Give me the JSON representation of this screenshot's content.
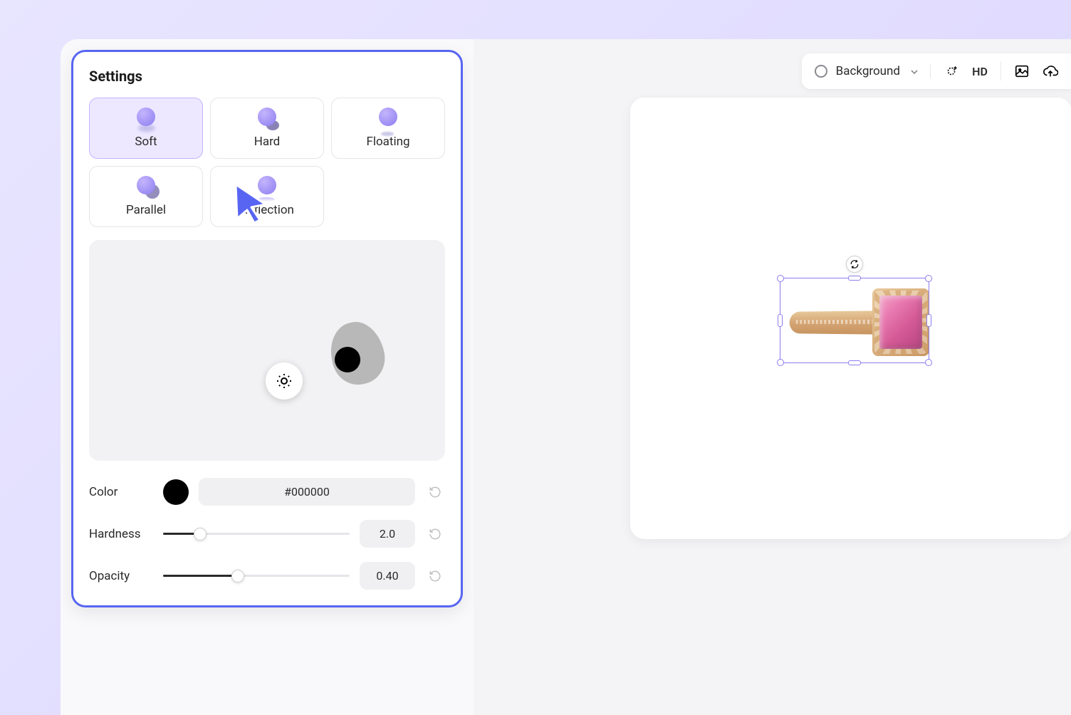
{
  "settings": {
    "title": "Settings",
    "presets": [
      {
        "label": "Soft",
        "selected": true
      },
      {
        "label": "Hard",
        "selected": false
      },
      {
        "label": "Floating",
        "selected": false
      },
      {
        "label": "Parallel",
        "selected": false
      },
      {
        "label": "Reflection",
        "selected": false
      }
    ],
    "controls": {
      "color": {
        "label": "Color",
        "value": "#000000",
        "swatch": "#000000"
      },
      "hardness": {
        "label": "Hardness",
        "value": "2.0",
        "percent": 20
      },
      "opacity": {
        "label": "Opacity",
        "value": "0.40",
        "percent": 40
      }
    }
  },
  "toolbar": {
    "background_label": "Background",
    "hd_label": "HD"
  },
  "colors": {
    "accent": "#5865f2",
    "preset_selected_bg": "#ede8ff"
  }
}
